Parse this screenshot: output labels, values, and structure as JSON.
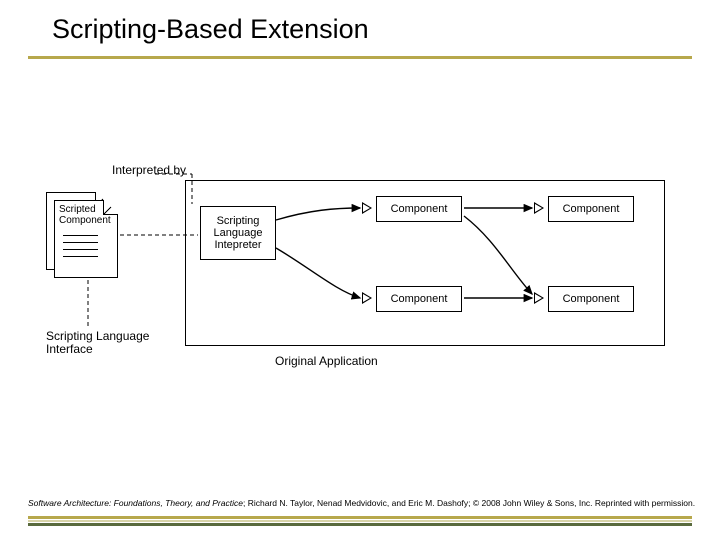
{
  "title": "Scripting-Based Extension",
  "labels": {
    "interpreted_by": "Interpreted by",
    "scripting_interface": "Scripting Language\nInterface",
    "original_app": "Original Application"
  },
  "boxes": {
    "scripted_component": "Scripted\nComponent",
    "interpreter": "Scripting\nLanguage\nIntepreter",
    "component": "Component"
  },
  "footer": {
    "book": "Software Architecture: Foundations, Theory, and Practice",
    "rest": "; Richard N. Taylor, Nenad Medvidovic, and Eric M. Dashofy; © 2008 John Wiley & Sons, Inc. Reprinted with permission."
  }
}
